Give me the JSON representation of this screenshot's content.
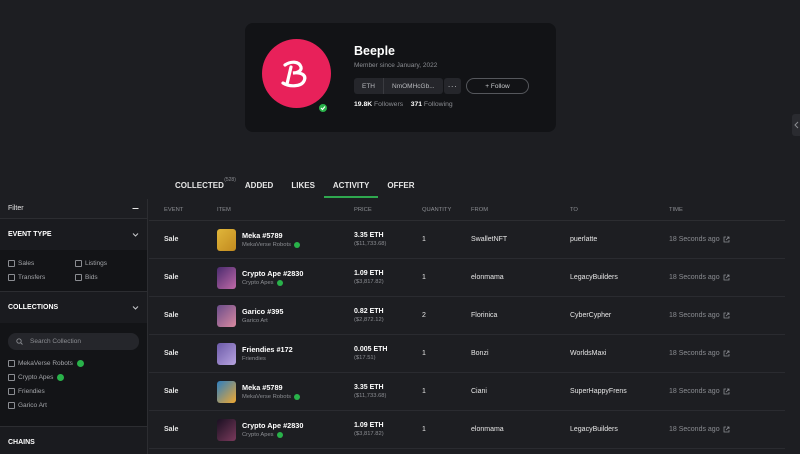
{
  "profile": {
    "name": "Beeple",
    "member_since": "Member since January, 2022",
    "chain": "ETH",
    "address": "NmOMHcGb...",
    "more_label": "···",
    "follow_label": "+ Follow",
    "followers_count": "19.8K",
    "followers_label": "Followers",
    "following_count": "371",
    "following_label": "Following",
    "brand_color": "#e8215a",
    "verified_color": "#29b24a"
  },
  "tabs": [
    {
      "label": "COLLECTED",
      "count": "(528)"
    },
    {
      "label": "ADDED"
    },
    {
      "label": "LIKES"
    },
    {
      "label": "ACTIVITY",
      "active": true
    },
    {
      "label": "OFFER"
    }
  ],
  "sidebar": {
    "filter_label": "Filter",
    "event_type_title": "EVENT TYPE",
    "event_types": [
      "Sales",
      "Listings",
      "Transfers",
      "Bids"
    ],
    "collections_title": "COLLECTIONS",
    "search_placeholder": "Search Collection",
    "collections": [
      {
        "name": "MekaVerse Robots",
        "verified": true
      },
      {
        "name": "Crypto Apes",
        "verified": true
      },
      {
        "name": "Friendies",
        "verified": false
      },
      {
        "name": "Garico Art",
        "verified": false
      }
    ],
    "chains_title": "CHAINS"
  },
  "table": {
    "headers": {
      "event": "EVENT",
      "item": "ITEM",
      "price": "PRICE",
      "quantity": "QUANTITY",
      "from": "FROM",
      "to": "TO",
      "time": "TIME"
    },
    "rows": [
      {
        "event": "Sale",
        "item": "Meka #5789",
        "collection": "MekaVerse Robots",
        "verified": true,
        "price": "3.35 ETH",
        "usd": "($11,733.68)",
        "qty": "1",
        "from": "SwalletNFT",
        "to": "puerlatte",
        "time": "18 Seconds ago"
      },
      {
        "event": "Sale",
        "item": "Crypto Ape #2830",
        "collection": "Crypto Apes",
        "verified": true,
        "price": "1.09 ETH",
        "usd": "($3,817.82)",
        "qty": "1",
        "from": "elonmama",
        "to": "LegacyBuilders",
        "time": "18 Seconds ago"
      },
      {
        "event": "Sale",
        "item": "Garico #395",
        "collection": "Garico Art",
        "verified": false,
        "price": "0.82 ETH",
        "usd": "($2,872.12)",
        "qty": "2",
        "from": "Florinica",
        "to": "CyberCypher",
        "time": "18 Seconds ago"
      },
      {
        "event": "Sale",
        "item": "Friendies #172",
        "collection": "Friendies",
        "verified": false,
        "price": "0.005 ETH",
        "usd": "($17.51)",
        "qty": "1",
        "from": "Bonzi",
        "to": "WorldsMaxi",
        "time": "18 Seconds ago"
      },
      {
        "event": "Sale",
        "item": "Meka #5789",
        "collection": "MekaVerse Robots",
        "verified": true,
        "price": "3.35 ETH",
        "usd": "($11,733.68)",
        "qty": "1",
        "from": "Ciani",
        "to": "SuperHappyFrens",
        "time": "18 Seconds ago"
      },
      {
        "event": "Sale",
        "item": "Crypto Ape #2830",
        "collection": "Crypto Apes",
        "verified": true,
        "price": "1.09 ETH",
        "usd": "($3,817.82)",
        "qty": "1",
        "from": "elonmama",
        "to": "LegacyBuilders",
        "time": "18 Seconds ago"
      }
    ]
  }
}
